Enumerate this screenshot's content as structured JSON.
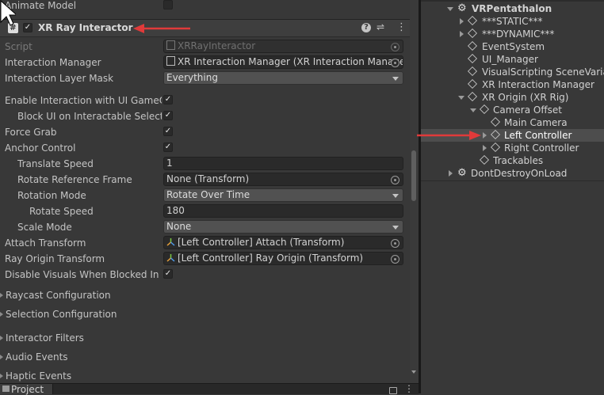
{
  "inspector": {
    "animate_model_label": "Animate Model",
    "component": {
      "title": "XR Ray Interactor",
      "enabled": true,
      "script_icon": "#",
      "help_icon": "?",
      "settings_icon": "⇌",
      "menu_icon": "⋮"
    },
    "script": {
      "label": "Script",
      "value": "XRRayInteractor"
    },
    "interaction_manager": {
      "label": "Interaction Manager",
      "value": "XR Interaction Manager (XR Interaction Manager"
    },
    "interaction_layer_mask": {
      "label": "Interaction Layer Mask",
      "value": "Everything"
    },
    "enable_ui": {
      "label": "Enable Interaction with UI GameOb",
      "checked": "✓"
    },
    "block_ui": {
      "label": "Block UI on Interactable Selectio",
      "checked": "✓"
    },
    "force_grab": {
      "label": "Force Grab",
      "checked": "✓"
    },
    "anchor_control": {
      "label": "Anchor Control",
      "checked": "✓"
    },
    "translate_speed": {
      "label": "Translate Speed",
      "value": "1"
    },
    "rotate_reference_frame": {
      "label": "Rotate Reference Frame",
      "value": "None (Transform)"
    },
    "rotation_mode": {
      "label": "Rotation Mode",
      "value": "Rotate Over Time"
    },
    "rotate_speed": {
      "label": "Rotate Speed",
      "value": "180"
    },
    "scale_mode": {
      "label": "Scale Mode",
      "value": "None"
    },
    "attach_transform": {
      "label": "Attach Transform",
      "value": "[Left Controller] Attach (Transform)"
    },
    "ray_origin_transform": {
      "label": "Ray Origin Transform",
      "value": "[Left Controller] Ray Origin (Transform)"
    },
    "disable_visuals": {
      "label": "Disable Visuals When Blocked In Gr",
      "checked": "✓"
    },
    "sections": {
      "raycast": "Raycast Configuration",
      "selection": "Selection Configuration",
      "interactor_filters": "Interactor Filters",
      "audio": "Audio Events",
      "haptic": "Haptic Events"
    }
  },
  "project_tab": {
    "label": "Project"
  },
  "hierarchy": {
    "items": [
      {
        "label": "VRPentathalon"
      },
      {
        "label": "***STATIC***"
      },
      {
        "label": "***DYNAMIC***"
      },
      {
        "label": "EventSystem"
      },
      {
        "label": "UI_Manager"
      },
      {
        "label": "VisualScripting SceneVariab"
      },
      {
        "label": "XR Interaction Manager"
      },
      {
        "label": "XR Origin (XR Rig)"
      },
      {
        "label": "Camera Offset"
      },
      {
        "label": "Main Camera"
      },
      {
        "label": "Left Controller"
      },
      {
        "label": "Right Controller"
      },
      {
        "label": "Trackables"
      },
      {
        "label": "DontDestroyOnLoad"
      }
    ]
  },
  "colors": {
    "arrow": "#e03a3a",
    "selection": "#4d4d4d"
  }
}
